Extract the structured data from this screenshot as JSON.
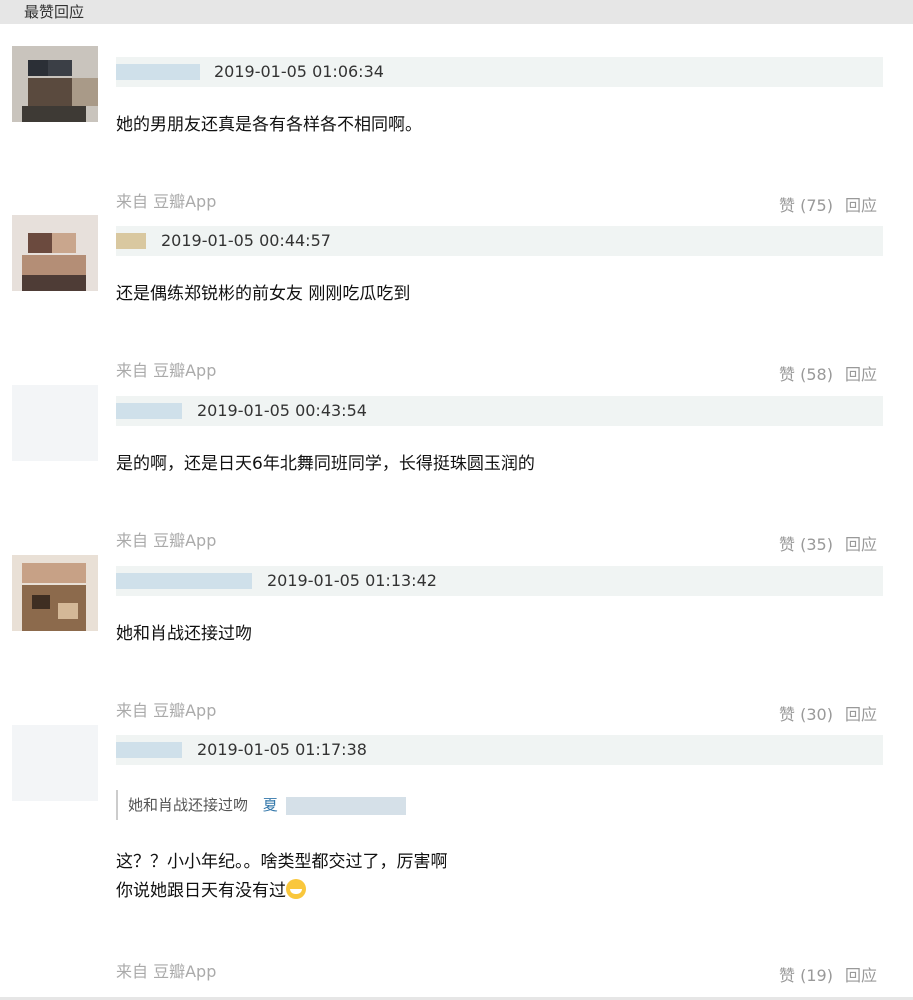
{
  "header": {
    "title": "最赞回应"
  },
  "comments": [
    {
      "time": "2019-01-05 01:06:34",
      "text": "她的男朋友还真是各有各样各不相同啊。",
      "source": "来自 豆瓣App",
      "likes": "赞 (75)",
      "reply": "回应"
    },
    {
      "time": "2019-01-05 00:44:57",
      "text": "还是偶练郑锐彬的前女友 刚刚吃瓜吃到",
      "source": "来自 豆瓣App",
      "likes": "赞 (58)",
      "reply": "回应"
    },
    {
      "time": "2019-01-05 00:43:54",
      "text": "是的啊，还是日天6年北舞同班同学，长得挺珠圆玉润的",
      "source": "来自 豆瓣App",
      "likes": "赞 (35)",
      "reply": "回应"
    },
    {
      "time": "2019-01-05 01:13:42",
      "text": "她和肖战还接过吻",
      "source": "来自 豆瓣App",
      "likes": "赞 (30)",
      "reply": "回应"
    },
    {
      "time": "2019-01-05 01:17:38",
      "quote": "她和肖战还接过吻",
      "quote_author_initial": "夏",
      "text_line1": "这？？小小年纪。。啥类型都交过了，厉害啊",
      "text_line2": "你说她跟日天有没有过",
      "source": "来自 豆瓣App",
      "likes": "赞 (19)",
      "reply": "回应"
    }
  ],
  "icons": {
    "emoji": "grinning-emoji-icon"
  }
}
